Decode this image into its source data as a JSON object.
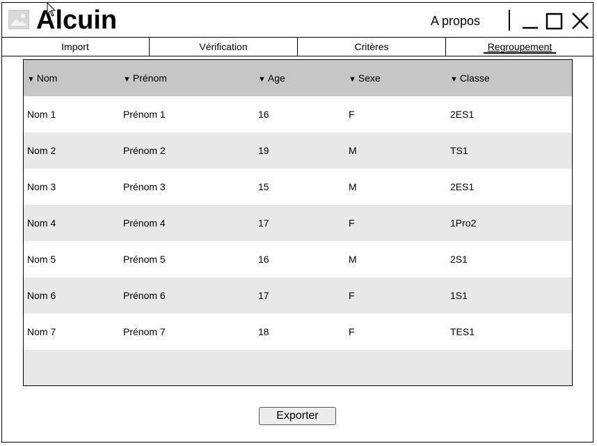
{
  "app": {
    "title": "Alcuin",
    "about": "A propos"
  },
  "tabs": [
    {
      "label": "Import"
    },
    {
      "label": "Vérification"
    },
    {
      "label": "Critères"
    },
    {
      "label": "Regroupement"
    }
  ],
  "table": {
    "columns": [
      "Nom",
      "Prénom",
      "Age",
      "Sexe",
      "Classe"
    ],
    "rows": [
      [
        "Nom 1",
        "Prénom 1",
        "16",
        "F",
        "2ES1"
      ],
      [
        "Nom 2",
        "Prénom 2",
        "19",
        "M",
        "TS1"
      ],
      [
        "Nom 3",
        "Prénom 3",
        "15",
        "M",
        "2ES1"
      ],
      [
        "Nom 4",
        "Prénom 4",
        "17",
        "F",
        "1Pro2"
      ],
      [
        "Nom 5",
        "Prénom 5",
        "16",
        "M",
        "2S1"
      ],
      [
        "Nom 6",
        "Prénom 6",
        "17",
        "F",
        "1S1"
      ],
      [
        "Nom 7",
        "Prénom 7",
        "18",
        "F",
        "TES1"
      ]
    ]
  },
  "actions": {
    "export": "Exporter"
  },
  "icons": {
    "logo": "image-placeholder-icon",
    "minimize": "minimize-icon",
    "maximize": "maximize-icon",
    "close": "close-icon",
    "sort": "sort-down-icon"
  }
}
